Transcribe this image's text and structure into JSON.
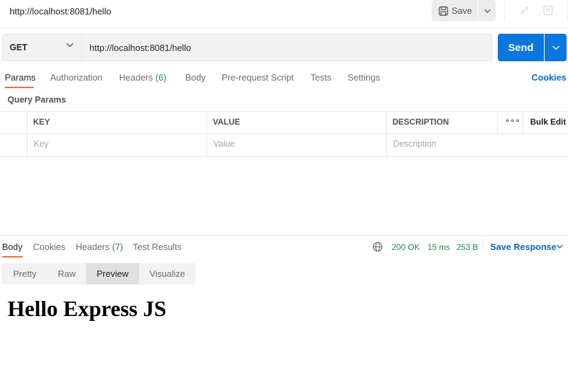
{
  "titlebar": {
    "request_name": "http://localhost:8081/hello",
    "save_label": "Save"
  },
  "urlbar": {
    "method": "GET",
    "url": "http://localhost:8081/hello",
    "send_label": "Send"
  },
  "request_tabs": {
    "params": "Params",
    "authorization": "Authorization",
    "headers": "Headers",
    "headers_count": "(6)",
    "body": "Body",
    "prerequest": "Pre-request Script",
    "tests": "Tests",
    "settings": "Settings",
    "cookies": "Cookies"
  },
  "query_params": {
    "section_label": "Query Params",
    "columns": {
      "key": "KEY",
      "value": "VALUE",
      "description": "DESCRIPTION",
      "more": "∘∘∘",
      "bulk_edit": "Bulk Edit"
    },
    "placeholders": {
      "key": "Key",
      "value": "Value",
      "description": "Description"
    }
  },
  "response": {
    "tabs": {
      "body": "Body",
      "cookies": "Cookies",
      "headers": "Headers",
      "headers_count": "(7)",
      "tests": "Test Results"
    },
    "status": "200 OK",
    "time": "15 ms",
    "size": "253 B",
    "save_response": "Save Response",
    "views": {
      "pretty": "Pretty",
      "raw": "Raw",
      "preview": "Preview",
      "visualize": "Visualize"
    },
    "preview_content": "Hello Express JS"
  },
  "colors": {
    "accent": "#f26b3a",
    "send": "#0b76df",
    "link": "#0b66c8",
    "success": "#1d8a4a"
  }
}
